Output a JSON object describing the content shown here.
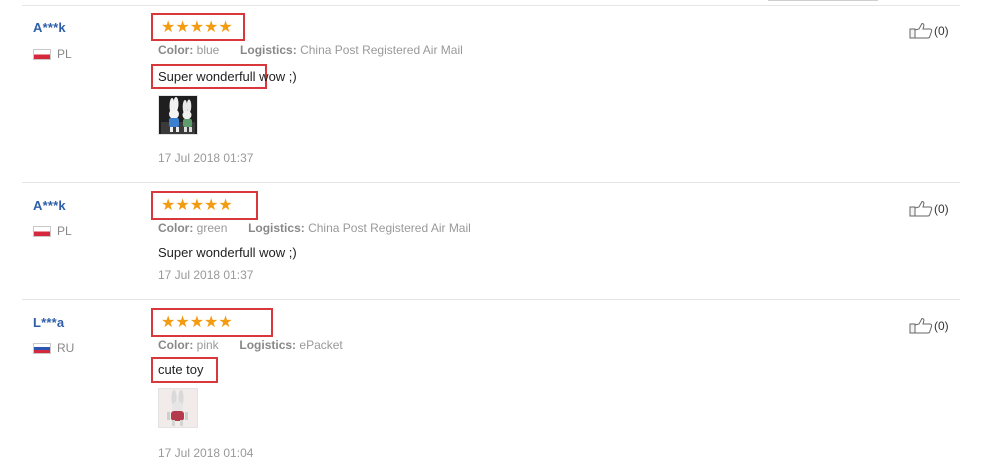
{
  "reviews": [
    {
      "buyer": "A***k",
      "country": "PL",
      "rating": "★★★★★",
      "color_label": "Color:",
      "color_value": "blue",
      "logistics_label": "Logistics:",
      "logistics_value": "China Post Registered Air Mail",
      "comment_highlighted": "Super wonderfull",
      "comment_rest": " wow ;)",
      "has_photo": true,
      "date": "17 Jul 2018 01:37",
      "likes": "(0)"
    },
    {
      "buyer": "A***k",
      "country": "PL",
      "rating": "★★★★★",
      "color_label": "Color:",
      "color_value": "green",
      "logistics_label": "Logistics:",
      "logistics_value": "China Post Registered Air Mail",
      "comment": "Super wonderfull wow ;)",
      "has_photo": false,
      "date": "17 Jul 2018 01:37",
      "likes": "(0)"
    },
    {
      "buyer": "L***a",
      "country": "RU",
      "rating": "★★★★★",
      "color_label": "Color:",
      "color_value": "pink",
      "logistics_label": "Logistics:",
      "logistics_value": "ePacket",
      "comment": "cute toy",
      "has_photo": true,
      "date": "17 Jul 2018 01:04",
      "likes": "(0)"
    }
  ],
  "colors": {
    "link": "#2f5ea8",
    "star": "#f39c12",
    "highlight": "#d8383b"
  },
  "icons": {
    "like": "thumbs-up-icon"
  }
}
